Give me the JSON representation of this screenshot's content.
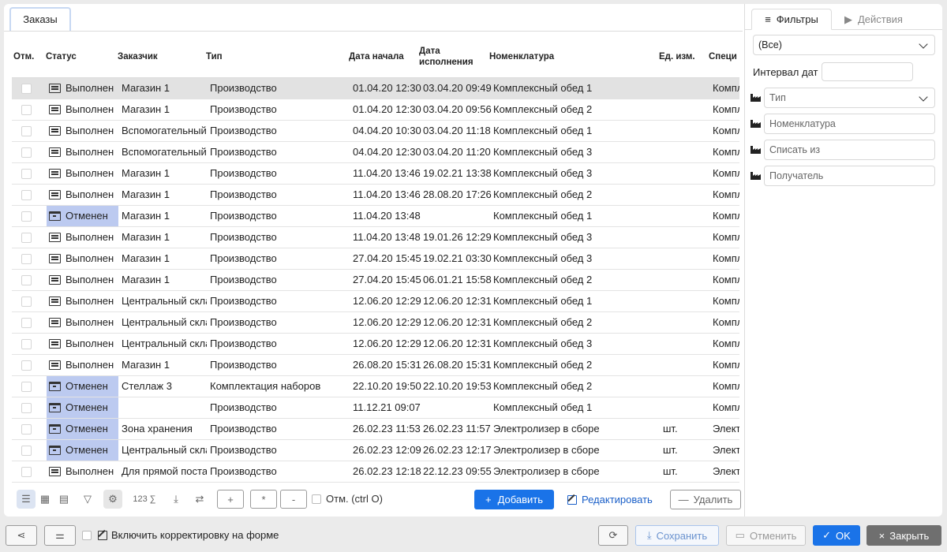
{
  "tab": {
    "label": "Заказы"
  },
  "grid": {
    "columns": [
      "Отм.",
      "Статус",
      "Заказчик",
      "Тип",
      "Дата начала",
      "Дата исполнения",
      "Номенклатура",
      "Ед. изм.",
      "Специ"
    ],
    "rows": [
      {
        "status": "Выполнен",
        "cancel": false,
        "customer": "Магазин 1",
        "type": "Производство",
        "start": "01.04.20 12:30",
        "done": "03.04.20 09:49",
        "nomen": "Комплексный обед 1",
        "unit": "",
        "spec": "Компл",
        "selected": true
      },
      {
        "status": "Выполнен",
        "cancel": false,
        "customer": "Магазин 1",
        "type": "Производство",
        "start": "01.04.20 12:30",
        "done": "03.04.20 09:56",
        "nomen": "Комплексный обед 2",
        "unit": "",
        "spec": "Компл"
      },
      {
        "status": "Выполнен",
        "cancel": false,
        "customer": "Вспомогательный",
        "type": "Производство",
        "start": "04.04.20 10:30",
        "done": "03.04.20 11:18",
        "nomen": "Комплексный обед 1",
        "unit": "",
        "spec": "Компл"
      },
      {
        "status": "Выполнен",
        "cancel": false,
        "customer": "Вспомогательный",
        "type": "Производство",
        "start": "04.04.20 12:30",
        "done": "03.04.20 11:20",
        "nomen": "Комплексный обед 3",
        "unit": "",
        "spec": "Компл"
      },
      {
        "status": "Выполнен",
        "cancel": false,
        "customer": "Магазин 1",
        "type": "Производство",
        "start": "11.04.20 13:46",
        "done": "19.02.21 13:38",
        "nomen": "Комплексный обед 3",
        "unit": "",
        "spec": "Компл"
      },
      {
        "status": "Выполнен",
        "cancel": false,
        "customer": "Магазин 1",
        "type": "Производство",
        "start": "11.04.20 13:46",
        "done": "28.08.20 17:26",
        "nomen": "Комплексный обед 2",
        "unit": "",
        "spec": "Компл"
      },
      {
        "status": "Отменен",
        "cancel": true,
        "customer": "Магазин 1",
        "type": "Производство",
        "start": "11.04.20 13:48",
        "done": "",
        "nomen": "Комплексный обед 1",
        "unit": "",
        "spec": "Компл"
      },
      {
        "status": "Выполнен",
        "cancel": false,
        "customer": "Магазин 1",
        "type": "Производство",
        "start": "11.04.20 13:48",
        "done": "19.01.26 12:29",
        "nomen": "Комплексный обед 3",
        "unit": "",
        "spec": "Компл"
      },
      {
        "status": "Выполнен",
        "cancel": false,
        "customer": "Магазин 1",
        "type": "Производство",
        "start": "27.04.20 15:45",
        "done": "19.02.21 03:30",
        "nomen": "Комплексный обед 3",
        "unit": "",
        "spec": "Компл"
      },
      {
        "status": "Выполнен",
        "cancel": false,
        "customer": "Магазин 1",
        "type": "Производство",
        "start": "27.04.20 15:45",
        "done": "06.01.21 15:58",
        "nomen": "Комплексный обед 2",
        "unit": "",
        "spec": "Компл"
      },
      {
        "status": "Выполнен",
        "cancel": false,
        "customer": "Центральный скла",
        "type": "Производство",
        "start": "12.06.20 12:29",
        "done": "12.06.20 12:31",
        "nomen": "Комплексный обед 1",
        "unit": "",
        "spec": "Компл"
      },
      {
        "status": "Выполнен",
        "cancel": false,
        "customer": "Центральный скла",
        "type": "Производство",
        "start": "12.06.20 12:29",
        "done": "12.06.20 12:31",
        "nomen": "Комплексный обед 2",
        "unit": "",
        "spec": "Компл"
      },
      {
        "status": "Выполнен",
        "cancel": false,
        "customer": "Центральный скла",
        "type": "Производство",
        "start": "12.06.20 12:29",
        "done": "12.06.20 12:31",
        "nomen": "Комплексный обед 3",
        "unit": "",
        "spec": "Компл"
      },
      {
        "status": "Выполнен",
        "cancel": false,
        "customer": "Магазин 1",
        "type": "Производство",
        "start": "26.08.20 15:31",
        "done": "26.08.20 15:31",
        "nomen": "Комплексный обед 2",
        "unit": "",
        "spec": "Компл"
      },
      {
        "status": "Отменен",
        "cancel": true,
        "customer": "Стеллаж 3",
        "type": "Комплектация наборов",
        "start": "22.10.20 19:50",
        "done": "22.10.20 19:53",
        "nomen": "Комплексный обед 2",
        "unit": "",
        "spec": "Компл"
      },
      {
        "status": "Отменен",
        "cancel": true,
        "customer": "",
        "type": "Производство",
        "start": "11.12.21 09:07",
        "done": "",
        "nomen": "Комплексный обед 1",
        "unit": "",
        "spec": "Компл"
      },
      {
        "status": "Отменен",
        "cancel": true,
        "customer": "Зона хранения",
        "type": "Производство",
        "start": "26.02.23 11:53",
        "done": "26.02.23 11:57",
        "nomen": "Электролизер в сборе",
        "unit": "шт.",
        "spec": "Электр"
      },
      {
        "status": "Отменен",
        "cancel": true,
        "customer": "Центральный скла",
        "type": "Производство",
        "start": "26.02.23 12:09",
        "done": "26.02.23 12:17",
        "nomen": "Электролизер в сборе",
        "unit": "шт.",
        "spec": "Электр"
      },
      {
        "status": "Выполнен",
        "cancel": false,
        "customer": "Для прямой поста",
        "type": "Производство",
        "start": "26.02.23 12:18",
        "done": "22.12.23 09:55",
        "nomen": "Электролизер в сборе",
        "unit": "шт.",
        "spec": "Электр"
      }
    ]
  },
  "toolbar": {
    "sum_label": "123 ∑",
    "plus": "+",
    "star": "*",
    "minus": "-",
    "mark_label": "Отм. (ctrl O)",
    "add_label": "Добавить",
    "edit_label": "Редактировать",
    "delete_label": "Удалить"
  },
  "panel": {
    "tab_filters": "Фильтры",
    "tab_actions": "Действия",
    "all_select": "(Все)",
    "date_interval_label": "Интервал дат",
    "type_placeholder": "Тип",
    "nomen_placeholder": "Номенклатура",
    "writeoff_placeholder": "Списать из",
    "recipient_placeholder": "Получатель"
  },
  "footer": {
    "edit_form_label": "Включить корректировку на форме",
    "save_label": "Сохранить",
    "cancel_label": "Отменить",
    "ok_label": "OK",
    "close_label": "Закрыть"
  },
  "colors": {
    "accent": "#1a73e8",
    "cancel_bg": "#bccaf0",
    "selected_row": "#e2e2e2"
  }
}
